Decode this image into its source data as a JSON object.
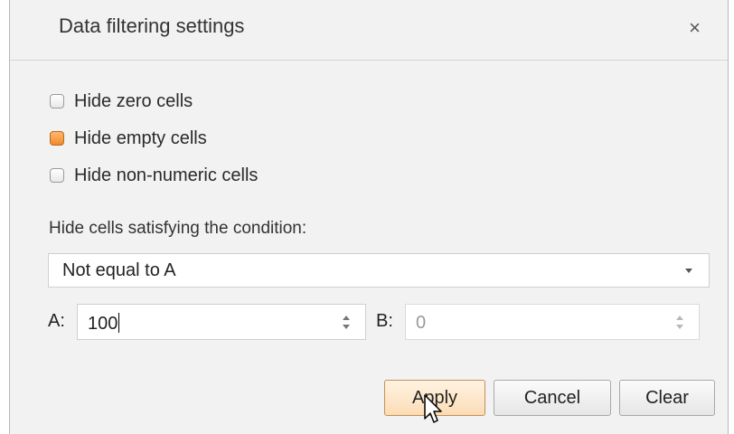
{
  "dialog": {
    "title": "Data filtering settings",
    "close_glyph": "×"
  },
  "options": [
    {
      "label": "Hide zero cells",
      "checked": false
    },
    {
      "label": "Hide empty cells",
      "checked": true
    },
    {
      "label": "Hide non-numeric cells",
      "checked": false
    }
  ],
  "condition": {
    "label": "Hide cells satisfying the condition:",
    "selected": "Not equal to A"
  },
  "params": {
    "a_label": "A:",
    "a_value": "100",
    "b_label": "B:",
    "b_value": "0",
    "b_disabled": true
  },
  "buttons": {
    "apply": "Apply",
    "cancel": "Cancel",
    "clear": "Clear"
  },
  "colors": {
    "checked_fill": "#f28a2a",
    "primary_button": "#fbdcb6"
  },
  "icons": {
    "close": "close-icon",
    "dropdown": "chevron-down-icon",
    "spinner": "spinner-arrows-icon",
    "cursor": "mouse-pointer-icon"
  }
}
